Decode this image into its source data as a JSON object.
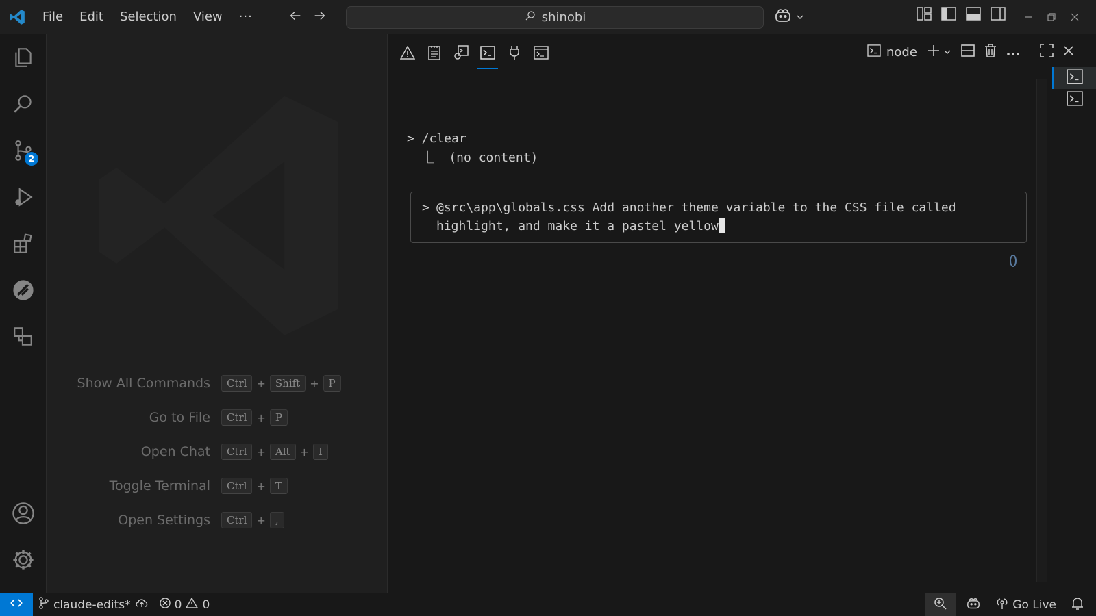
{
  "titlebar": {
    "menu": [
      "File",
      "Edit",
      "Selection",
      "View",
      "···"
    ],
    "search_text": "shinobi",
    "icons": {
      "logo": "vscode-logo-icon",
      "back": "arrow-left-icon",
      "forward": "arrow-right-icon",
      "search": "search-icon",
      "copilot": "copilot-icon",
      "customize_layout": "customize-layout-icon",
      "toggle_sidebar": "toggle-primary-sidebar-icon",
      "toggle_panel": "toggle-panel-icon",
      "toggle_secondary": "toggle-secondary-sidebar-icon",
      "minimize": "minimize-icon",
      "restore": "restore-icon",
      "close": "close-icon"
    }
  },
  "activitybar": {
    "items": [
      {
        "name": "explorer",
        "icon": "files-icon"
      },
      {
        "name": "search",
        "icon": "search-icon"
      },
      {
        "name": "source-control",
        "icon": "source-control-icon",
        "badge": "2"
      },
      {
        "name": "run-debug",
        "icon": "run-debug-icon"
      },
      {
        "name": "extensions",
        "icon": "extensions-icon"
      },
      {
        "name": "remote",
        "icon": "remote-explorer-icon"
      },
      {
        "name": "shapes",
        "icon": "shapes-icon"
      }
    ],
    "bottom": [
      {
        "name": "accounts",
        "icon": "account-icon"
      },
      {
        "name": "manage",
        "icon": "gear-icon"
      }
    ]
  },
  "editor": {
    "shortcuts": [
      {
        "label": "Show All Commands",
        "keys": [
          "Ctrl",
          "Shift",
          "P"
        ]
      },
      {
        "label": "Go to File",
        "keys": [
          "Ctrl",
          "P"
        ]
      },
      {
        "label": "Open Chat",
        "keys": [
          "Ctrl",
          "Alt",
          "I"
        ]
      },
      {
        "label": "Toggle Terminal",
        "keys": [
          "Ctrl",
          "T"
        ]
      },
      {
        "label": "Open Settings",
        "keys": [
          "Ctrl",
          ","
        ]
      }
    ]
  },
  "panel": {
    "tabs": [
      {
        "name": "problems",
        "icon": "warning-icon"
      },
      {
        "name": "output",
        "icon": "output-icon"
      },
      {
        "name": "debug-console",
        "icon": "debug-console-icon"
      },
      {
        "name": "terminal",
        "icon": "terminal-icon",
        "active": true
      },
      {
        "name": "ports",
        "icon": "plug-icon"
      },
      {
        "name": "comments",
        "icon": "window-terminal-icon"
      }
    ],
    "terminal_name": "node",
    "terminal": {
      "line1": "> /clear",
      "line2": "  ⎿  (no content)",
      "prompt_marker": ">",
      "prompt_line1": "@src\\app\\globals.css Add another theme variable to the CSS file called",
      "prompt_line2": "highlight, and make it a pastel yellow"
    }
  },
  "statusbar": {
    "branch": "claude-edits*",
    "errors": "0",
    "warnings": "0",
    "go_live": "Go Live"
  },
  "colors": {
    "accent": "#0078d4",
    "background": "#1e1e1e",
    "panel": "#181818"
  }
}
